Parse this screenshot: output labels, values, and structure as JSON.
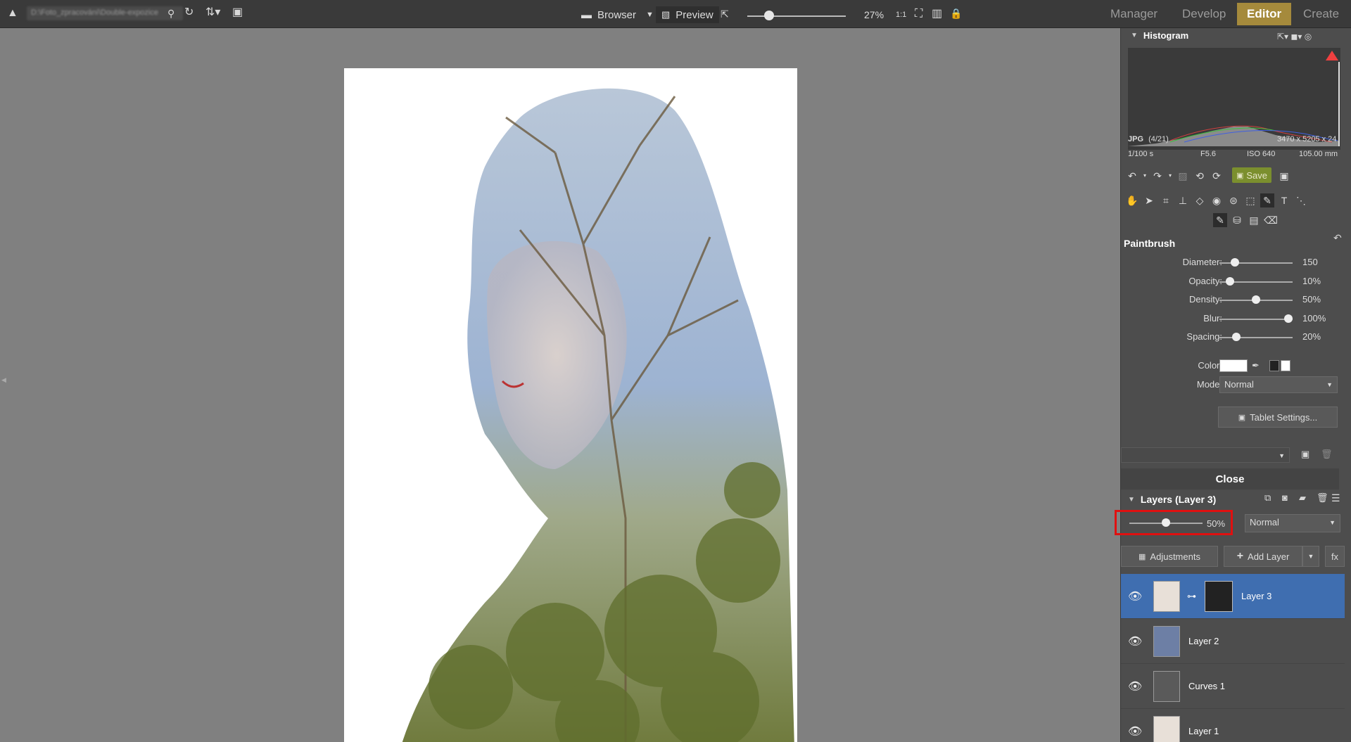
{
  "topbar": {
    "path": "D:\\Foto_zpracování\\Double-expozice",
    "browser_label": "Browser",
    "preview_label": "Preview",
    "zoom": "27%",
    "zoom_level": 0.27,
    "modules": [
      "Manager",
      "Develop",
      "Editor",
      "Create"
    ]
  },
  "histogram": {
    "title": "Histogram",
    "format": "JPG",
    "index": "(4/21)",
    "dimensions": "3470 x 5205 x 24",
    "shutter": "1/100 s",
    "aperture": "F5.6",
    "iso": "ISO 640",
    "focal": "105.00 mm"
  },
  "toolbar": {
    "save_label": "Save"
  },
  "paintbrush": {
    "title": "Paintbrush",
    "props": [
      {
        "label": "Diameter:",
        "value": "150",
        "fraction": 0.17
      },
      {
        "label": "Opacity:",
        "value": "10%",
        "fraction": 0.1
      },
      {
        "label": "Density:",
        "value": "50%",
        "fraction": 0.5
      },
      {
        "label": "Blur:",
        "value": "100%",
        "fraction": 1.0
      },
      {
        "label": "Spacing:",
        "value": "20%",
        "fraction": 0.2
      }
    ],
    "color_label": "Color:",
    "mode_label": "Mode:",
    "mode_value": "Normal",
    "tablet_label": "Tablet Settings...",
    "colors": {
      "brush": "#ffffff",
      "primary": "#222222",
      "secondary": "#ffffff"
    }
  },
  "close_label": "Close",
  "layers": {
    "title": "Layers (Layer 3)",
    "opacity": "50%",
    "opacity_fraction": 0.5,
    "blend": "Normal",
    "adjustments_label": "Adjustments",
    "add_layer_label": "Add Layer",
    "fx_label": "fx",
    "items": [
      {
        "name": "Layer 3"
      },
      {
        "name": "Layer 2"
      },
      {
        "name": "Curves 1"
      },
      {
        "name": "Layer 1"
      }
    ]
  },
  "colors": {
    "accent": "#a58a3c",
    "selection": "#3f6eb0",
    "save": "#7b8f2e",
    "highlight": "#e01010"
  }
}
